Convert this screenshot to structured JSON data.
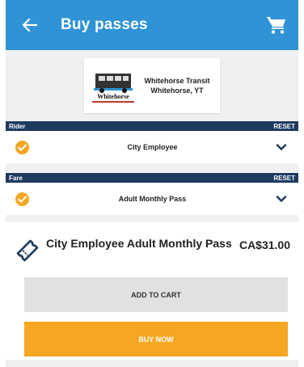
{
  "appbar": {
    "title": "Buy passes",
    "back_icon": "arrow-left-icon",
    "cart_icon": "cart-icon",
    "color": "#2f93d6"
  },
  "agency": {
    "logo_text": "Whitehorse",
    "name": "Whitehorse Transit",
    "location": "Whitehorse, YT"
  },
  "rider": {
    "label": "Rider",
    "reset": "RESET",
    "value": "City Employee"
  },
  "fare": {
    "label": "Fare",
    "reset": "RESET",
    "value": "Adult Monthly Pass"
  },
  "pass": {
    "name": "City Employee Adult Monthly Pass",
    "price": "CA$31.00",
    "add_to_cart": "ADD TO CART",
    "buy_now": "BUY NOW"
  },
  "colors": {
    "header": "#1e3a5f",
    "accent": "#f5a623",
    "secondary_button": "#e1e1e1"
  }
}
